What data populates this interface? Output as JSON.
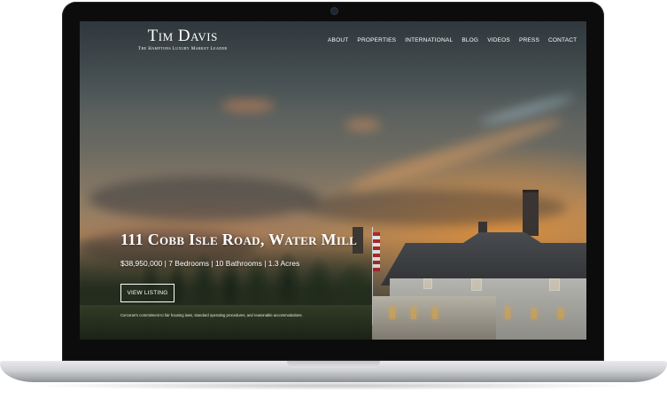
{
  "brand": {
    "name": "Tim Davis",
    "tagline": "The Hamptons Luxury Market Leader"
  },
  "nav": {
    "items": [
      "ABOUT",
      "PROPERTIES",
      "INTERNATIONAL",
      "BLOG",
      "VIDEOS",
      "PRESS",
      "CONTACT"
    ]
  },
  "hero": {
    "title": "111 Cobb Isle Road, Water Mill",
    "details": "$38,950,000 | 7 Bedrooms | 10 Bathrooms | 1.3 Acres",
    "button_label": "VIEW LISTING",
    "caption": "Corcoran's commitment to fair housing laws, standard operating procedures, and reasonable accommodations."
  },
  "colors": {
    "text": "#ffffff",
    "device_frame": "#0c0c0d",
    "device_base": "#cfd1d4"
  }
}
